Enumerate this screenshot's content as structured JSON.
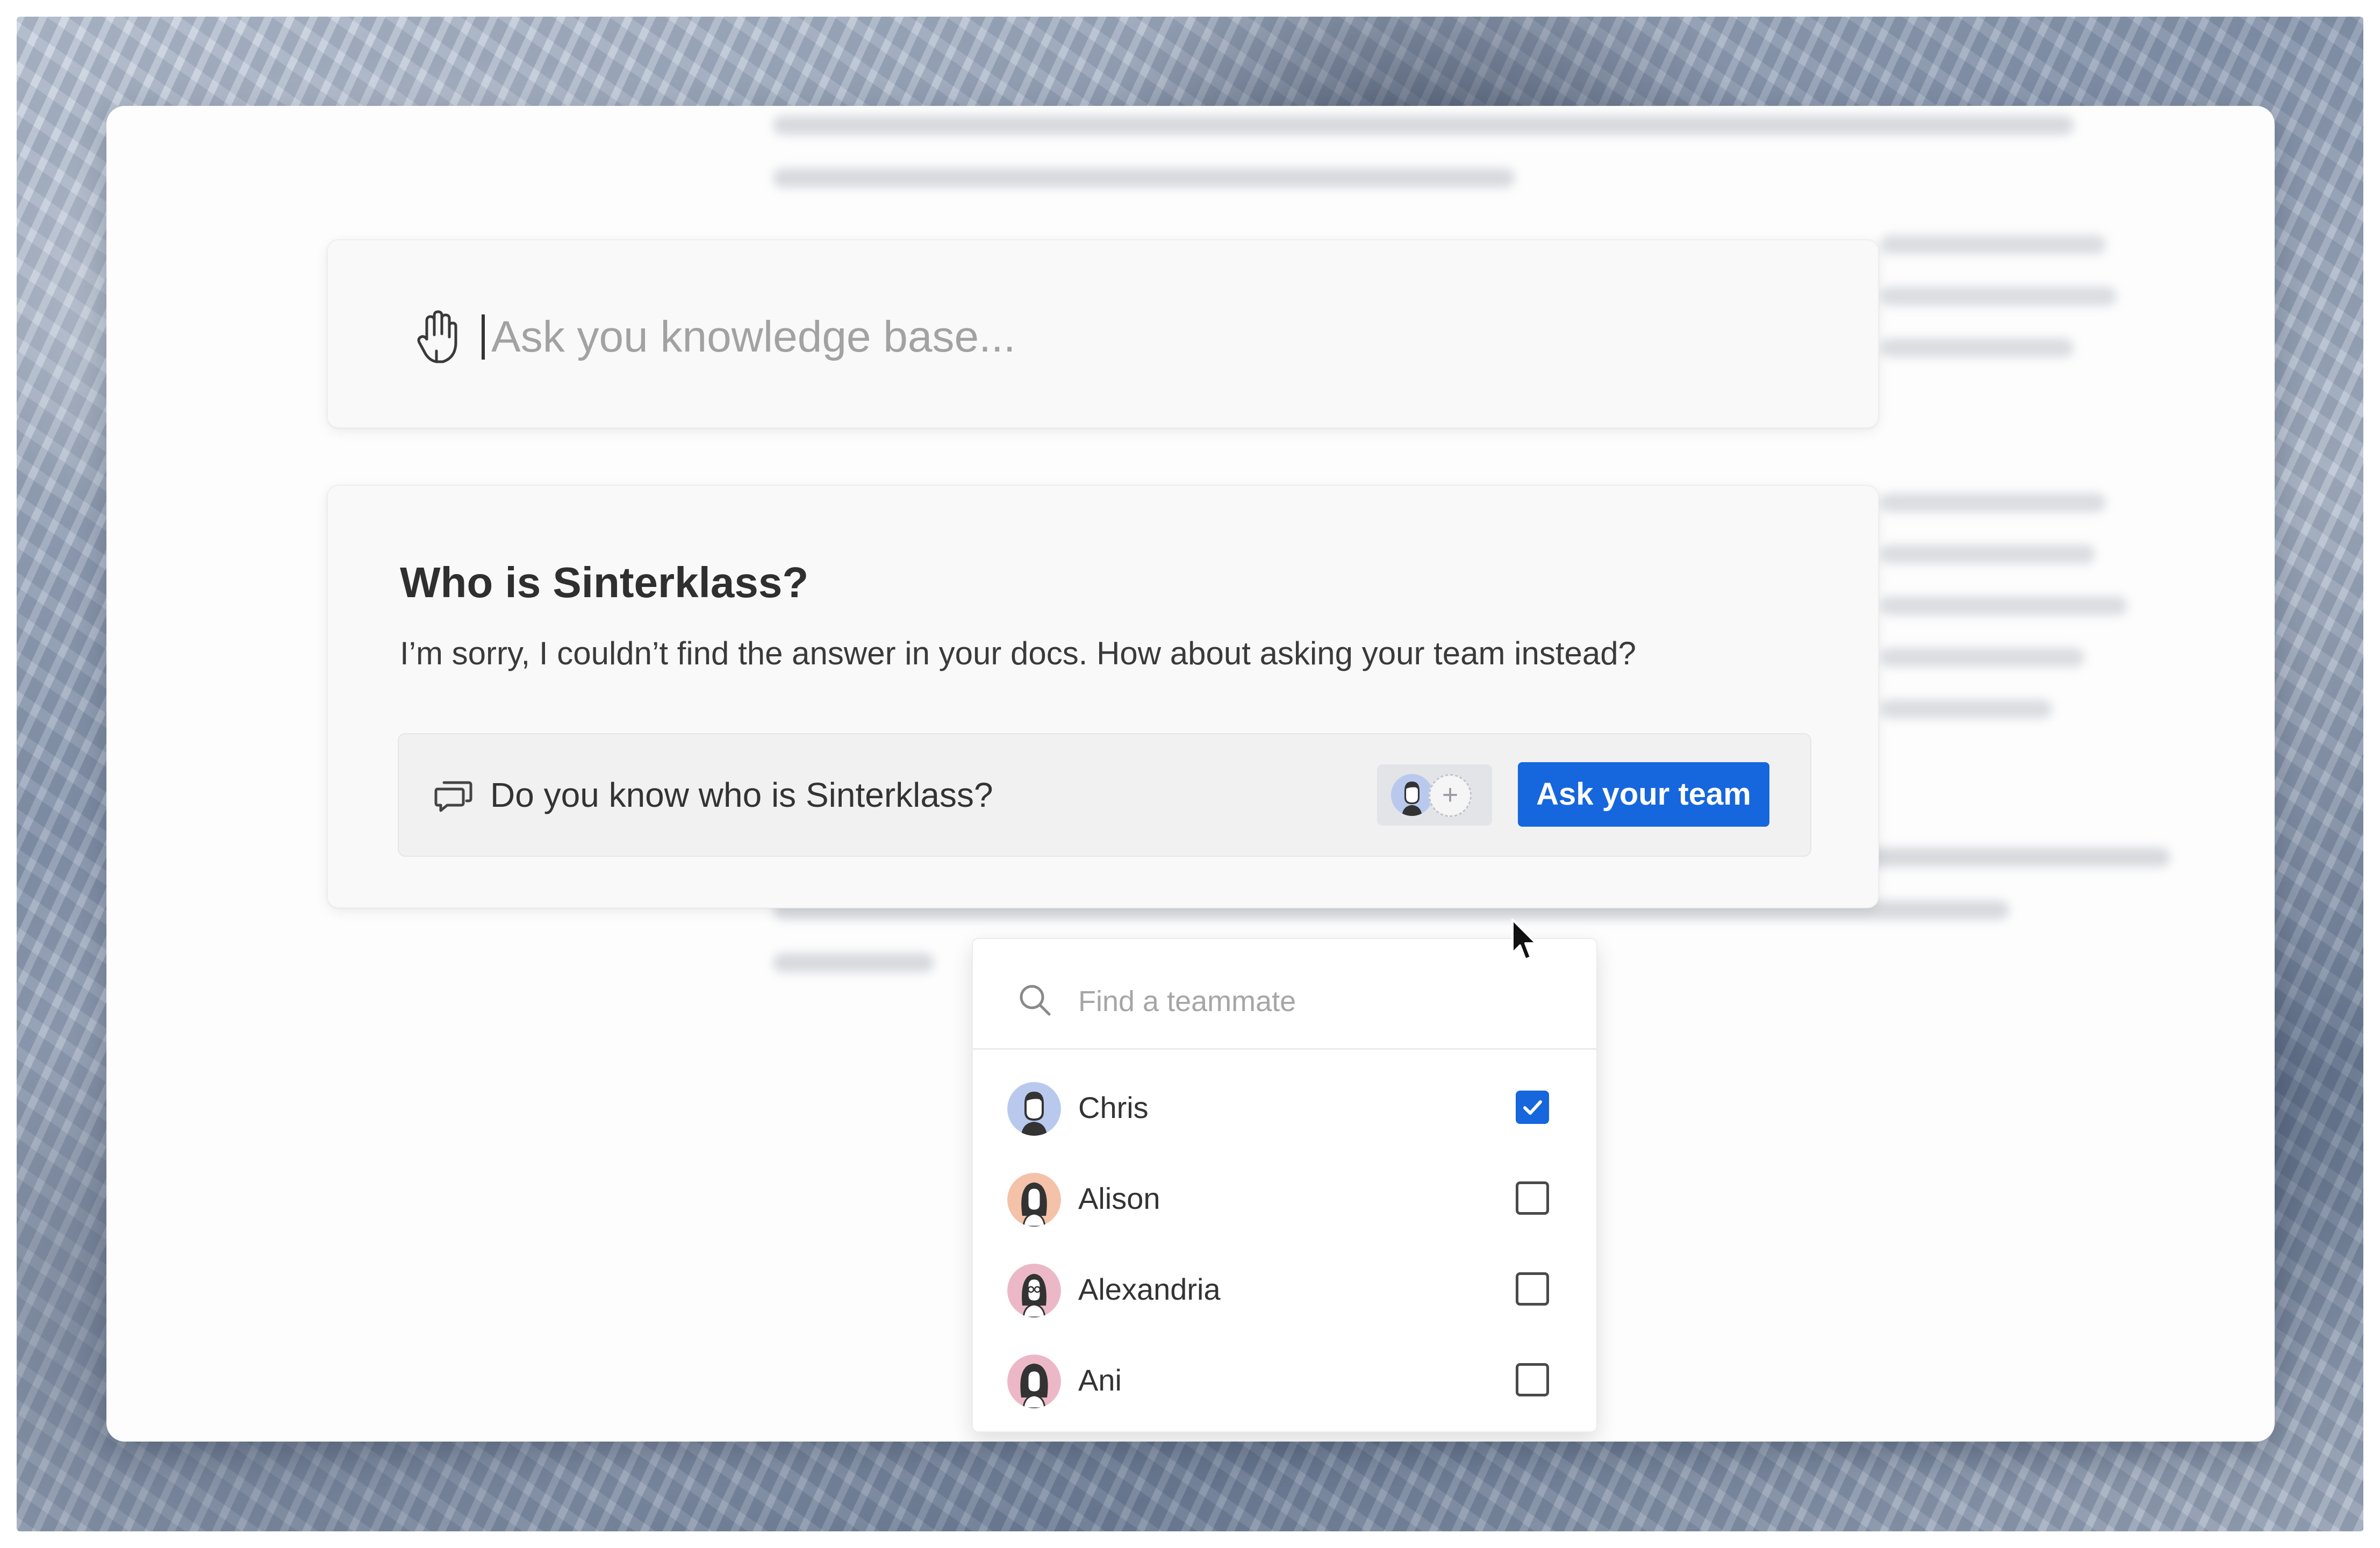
{
  "colors": {
    "accent": "#1666dd",
    "card_background": "#f9f9f9",
    "text_primary": "#2f2f2f",
    "placeholder": "#a2a2a2"
  },
  "search": {
    "icon": "hand-icon",
    "placeholder": "Ask you knowledge base..."
  },
  "answer": {
    "title": "Who is Sinterklass?",
    "message": "I’m sorry, I couldn’t find the answer in your docs. How about asking your team instead?",
    "question": {
      "icon": "chat-bubbles-icon",
      "text": "Do you know who is Sinterklass?"
    },
    "add_teammate_icon": "+",
    "ask_button_label": "Ask your team"
  },
  "teammate_picker": {
    "search_icon": "search-icon",
    "search_placeholder": "Find a teammate",
    "members": [
      {
        "name": "Chris",
        "checked": true,
        "avatar_color": "#b9c9ee"
      },
      {
        "name": "Alison",
        "checked": false,
        "avatar_color": "#f4c2a8"
      },
      {
        "name": "Alexandria",
        "checked": false,
        "avatar_color": "#ecb8c8"
      },
      {
        "name": "Ani",
        "checked": false,
        "avatar_color": "#ecb8c8"
      }
    ]
  }
}
